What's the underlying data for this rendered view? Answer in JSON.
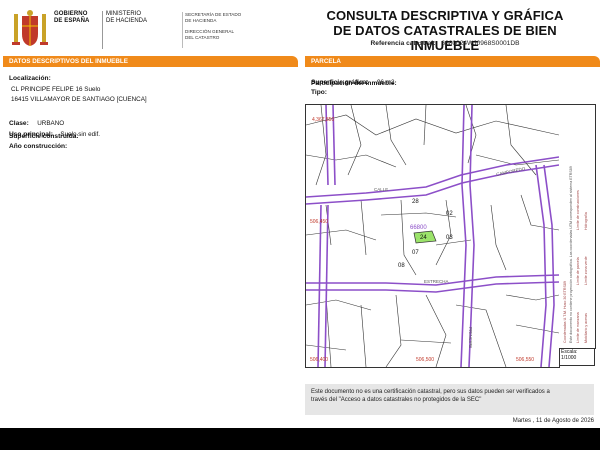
{
  "header": {
    "gov_lines": [
      "GOBIERNO",
      "DE ESPAÑA"
    ],
    "ministry_lines": [
      "MINISTERIO",
      "DE HACIENDA"
    ],
    "secretaria_lines": [
      "SECRETARÍA DE ESTADO",
      "DE HACIENDA"
    ],
    "direccion_lines": [
      "DIRECCIÓN GENERAL",
      "DEL CATASTRO"
    ]
  },
  "title": {
    "line1": "CONSULTA DESCRIPTIVA Y GRÁFICA",
    "line2": "DE DATOS CATASTRALES DE BIEN INMUEBLE",
    "ref_label": "Referencia catastral:",
    "ref_value": "6680024WJ0968S0001DB"
  },
  "left_section": {
    "header": "DATOS DESCRIPTIVOS DEL INMUEBLE",
    "localizacion_label": "Localización:",
    "address_line1": "CL PRINCIPE FELIPE 16 Suelo",
    "address_line2": "16415 VILLAMAYOR DE SANTIAGO [CUENCA]",
    "clase_label": "Clase:",
    "clase_value": "URBANO",
    "uso_label": "Uso principal:",
    "uso_value": "Suelo sin edif.",
    "superficie_label": "Superficie construida:",
    "anio_label": "Año construcción:"
  },
  "right_section": {
    "header": "PARCELA",
    "superficie_label": "Superficie gráfica:",
    "superficie_value": "96 m2",
    "participacion_label": "Participación del inmueble:",
    "tipo_label": "Tipo:"
  },
  "map": {
    "coords": {
      "top_left_x": "4,367,850",
      "left_y": "506,450",
      "bottom_left": "506,400",
      "bottom_mid": "506,500",
      "bottom_right": "506,550"
    },
    "street_labels": {
      "calle_left": "CALLE",
      "calle_top_right": "CAMPOREDO",
      "estrecha": "ESTRECHA",
      "principe": "PRINCIPE"
    },
    "parcel_codes": {
      "p28": "28",
      "p02": "02",
      "p24": "24",
      "p03": "03",
      "p07": "07",
      "p08": "08",
      "highlight_code": "66800"
    },
    "sidebar_lines": [
      "Límite de manzana",
      "Límite de parcela",
      "Límite de construcciones",
      "Mobiliario y aceras",
      "Límite zona verde",
      "Hidrografía"
    ],
    "sidebar_note": "Este documento no contiene proyección cartográfica. Las coordenadas UTM corresponden al sistema ETRS89",
    "sidebar_coord": "Coordenadas U.T.M. Huso 30 ETRS89",
    "scale_label": "Escala:",
    "scale_value": "1/1000"
  },
  "disclaimer": {
    "line1": "Este documento no es una certificación catastral, pero sus datos pueden ser verificados a",
    "line2": "través del \"Acceso a datos catastrales no protegidos de la SEC\""
  },
  "footer": {
    "date": "Martes , 11 de Agosto de 2026"
  },
  "colors": {
    "accent_orange": "#f08a1a",
    "street_purple": "#8c4fc8",
    "parcel_highlight": "#9be36a",
    "coord_red": "#c0392b"
  }
}
